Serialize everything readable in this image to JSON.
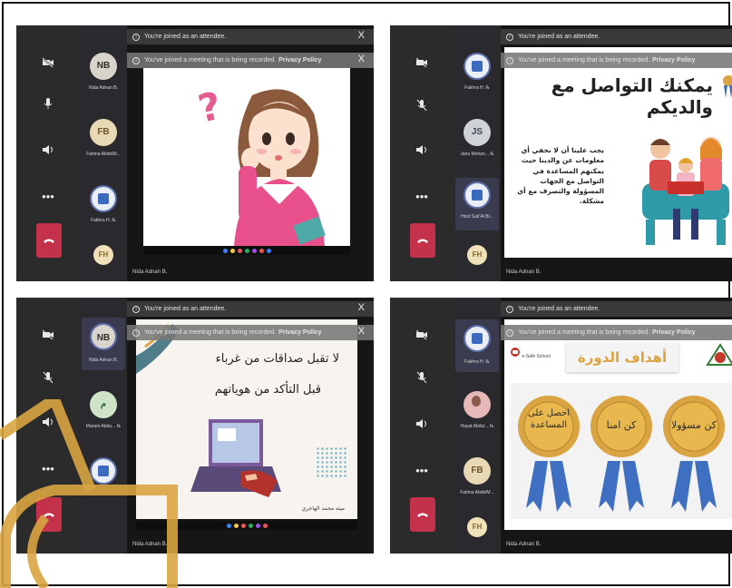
{
  "meeting": {
    "notice_attendee": "You're joined as an attendee.",
    "notice_recorded": "You've joined a meeting that is being recorded.",
    "privacy_link": "Privacy Policy",
    "presenter": "Nida Adnan B."
  },
  "icons": {
    "camera_off": "camera-off-icon",
    "mic_off": "mic-off-icon",
    "speaker": "speaker-icon",
    "more": "more-options-icon",
    "hang_up": "hang-up-icon",
    "close": "close-icon",
    "info": "info-icon"
  },
  "glyphs": {
    "close": "X",
    "info": "i",
    "more": "•••"
  },
  "colors": {
    "hang_up": "#c4314b",
    "gold": "#d9a441",
    "slide_text": "#222222"
  },
  "panels": [
    {
      "roster": [
        {
          "initials": "NB",
          "name": "Nida Adnan B."
        },
        {
          "initials": "FB",
          "name": "Fatima AbdelM..."
        },
        {
          "initials": "",
          "name": "Fakhra H. ℞"
        },
        {
          "initials": "FH",
          "name": ""
        }
      ],
      "slide": {
        "title": "",
        "body": ""
      }
    },
    {
      "roster": [
        {
          "initials": "",
          "name": "Fakhra H. ℞"
        },
        {
          "initials": "JS",
          "name": "Jana Mohan... ℞"
        },
        {
          "initials": "",
          "name": "Hind Saif Al Bl..."
        },
        {
          "initials": "FH",
          "name": ""
        }
      ],
      "slide": {
        "title": "يمكنك التواصل مع والديكم",
        "body": "يجب علينا أن لا نخفي أي معلومات عن والدينا حيث يمكنهم المساعدة في التواصل مع الجهات المسؤولة والتصرف مع أي مشكلة."
      }
    },
    {
      "roster": [
        {
          "initials": "NB",
          "name": "Nida Adnan B."
        },
        {
          "initials": "م",
          "name": "Maram Abdu... ℞"
        },
        {
          "initials": "",
          "name": ""
        }
      ],
      "slide": {
        "line1": "لا تقبل صداقات من غرباء",
        "line2": "قبل التأكد من هوياتهم",
        "credit": "ميثه محمد الهاجري"
      }
    },
    {
      "roster": [
        {
          "initials": "",
          "name": "Fakhra H. ℞"
        },
        {
          "initials": "",
          "name": "Hayat Abdul... ℞"
        },
        {
          "initials": "FB",
          "name": "Fatima AbdelM..."
        },
        {
          "initials": "FH",
          "name": ""
        }
      ],
      "slide": {
        "header": "أهداف الدورة",
        "school": "e-Safe School",
        "medal1": "احصل على المساعدة",
        "medal2": "كن امنا",
        "medal3": "كن مسؤولا"
      }
    }
  ]
}
